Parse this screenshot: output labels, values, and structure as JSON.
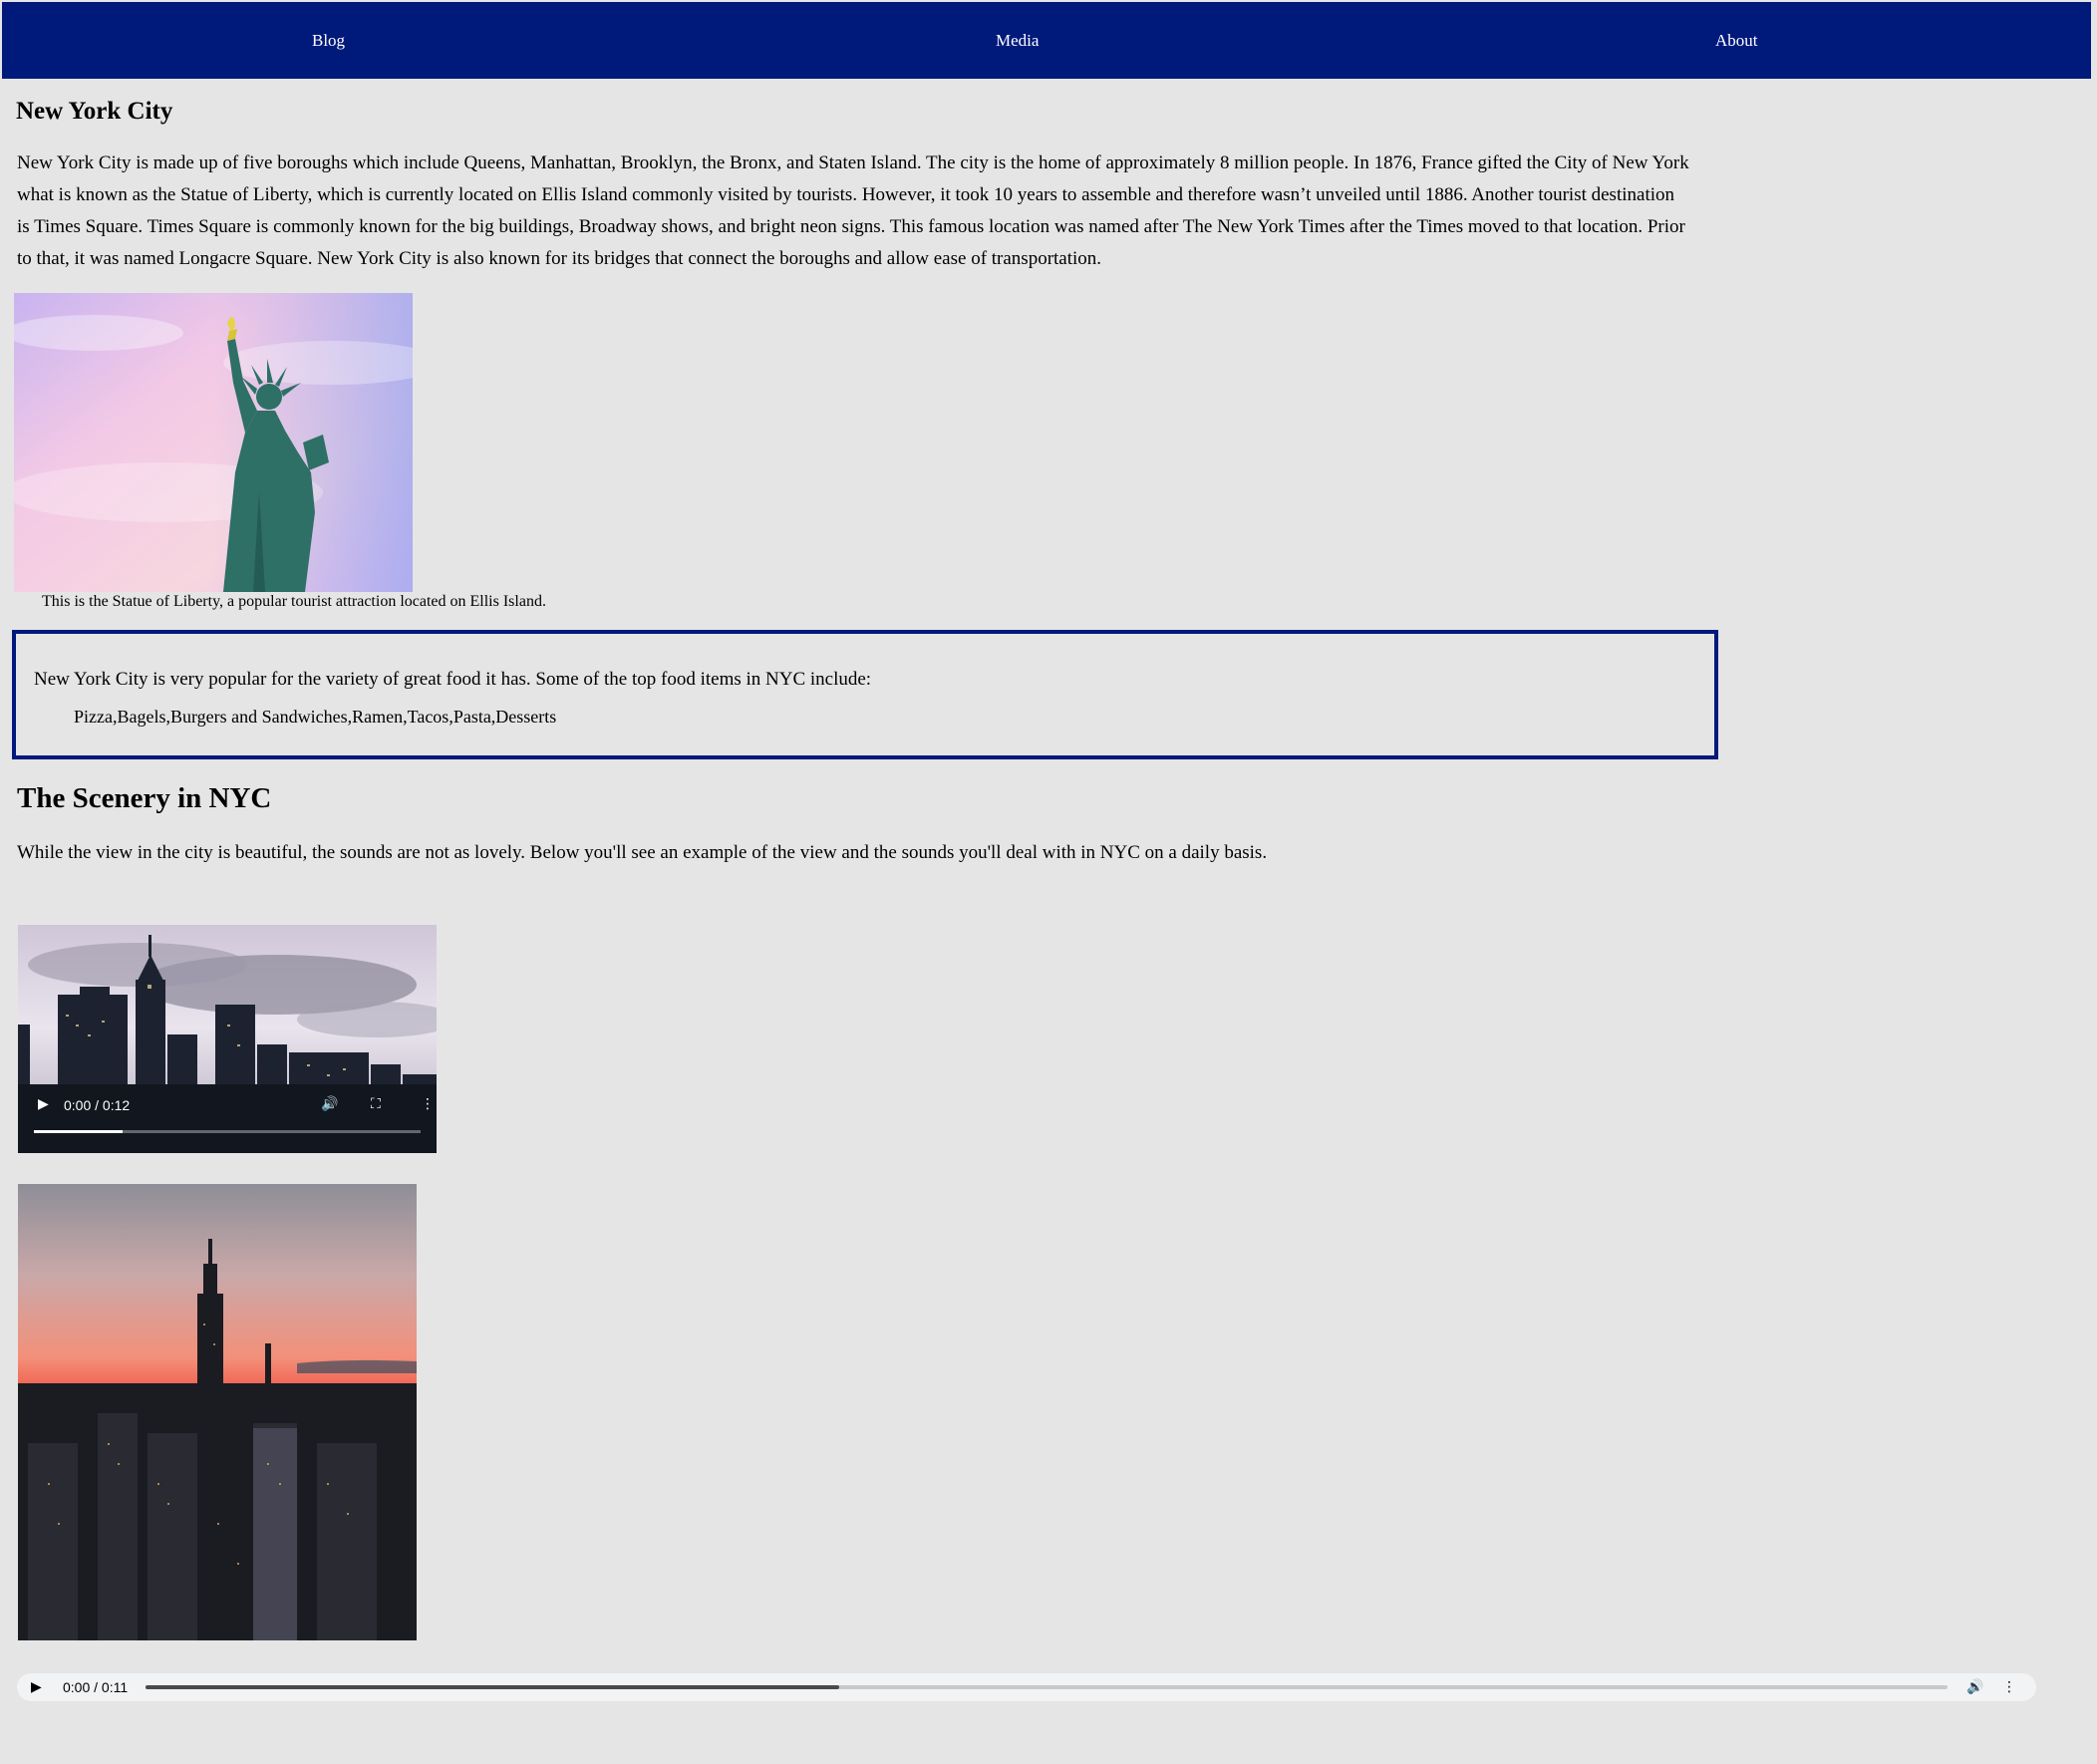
{
  "nav": {
    "items": [
      {
        "label": "Blog"
      },
      {
        "label": "Media"
      },
      {
        "label": "About"
      }
    ],
    "background": "#001a7c"
  },
  "article": {
    "title": "New York City",
    "intro": "New York City is made up of five boroughs which include Queens, Manhattan, Brooklyn, the Bronx, and Staten Island. The city is the home of approximately 8 million people. In 1876, France gifted the City of New York what is known as the Statue of Liberty, which is currently located on Ellis Island commonly visited by tourists. However, it took 10 years to assemble and therefore wasn’t unveiled until 1886. Another tourist destination is Times Square. Times Square is commonly known for the big buildings, Broadway shows, and bright neon signs. This famous location was named after The New York Times after the Times moved to that location. Prior to that, it was named Longacre Square. New York City is also known for its bridges that connect the boroughs and allow ease of transportation.",
    "statue_caption": "This is the Statue of Liberty, a popular tourist attraction located on Ellis Island."
  },
  "food": {
    "intro": "New York City is very popular for the variety of great food it has. Some of the top food items in NYC include:",
    "items": "Pizza,Bagels,Burgers and Sandwiches,Ramen,Tacos,Pasta,Desserts"
  },
  "scenery": {
    "title": "The Scenery in NYC",
    "text": "While the view in the city is beautiful, the sounds are not as lovely. Below you'll see an example of the view and the sounds you'll deal with in NYC on a daily basis."
  },
  "video": {
    "time": "0:00 / 0:12",
    "progress_fraction": 0.23
  },
  "audio": {
    "time": "0:00 / 0:11",
    "progress_fraction": 0.385
  },
  "icons": {
    "play": "play-icon",
    "volume": "volume-icon",
    "fullscreen": "fullscreen-icon",
    "more": "more-options-icon"
  }
}
